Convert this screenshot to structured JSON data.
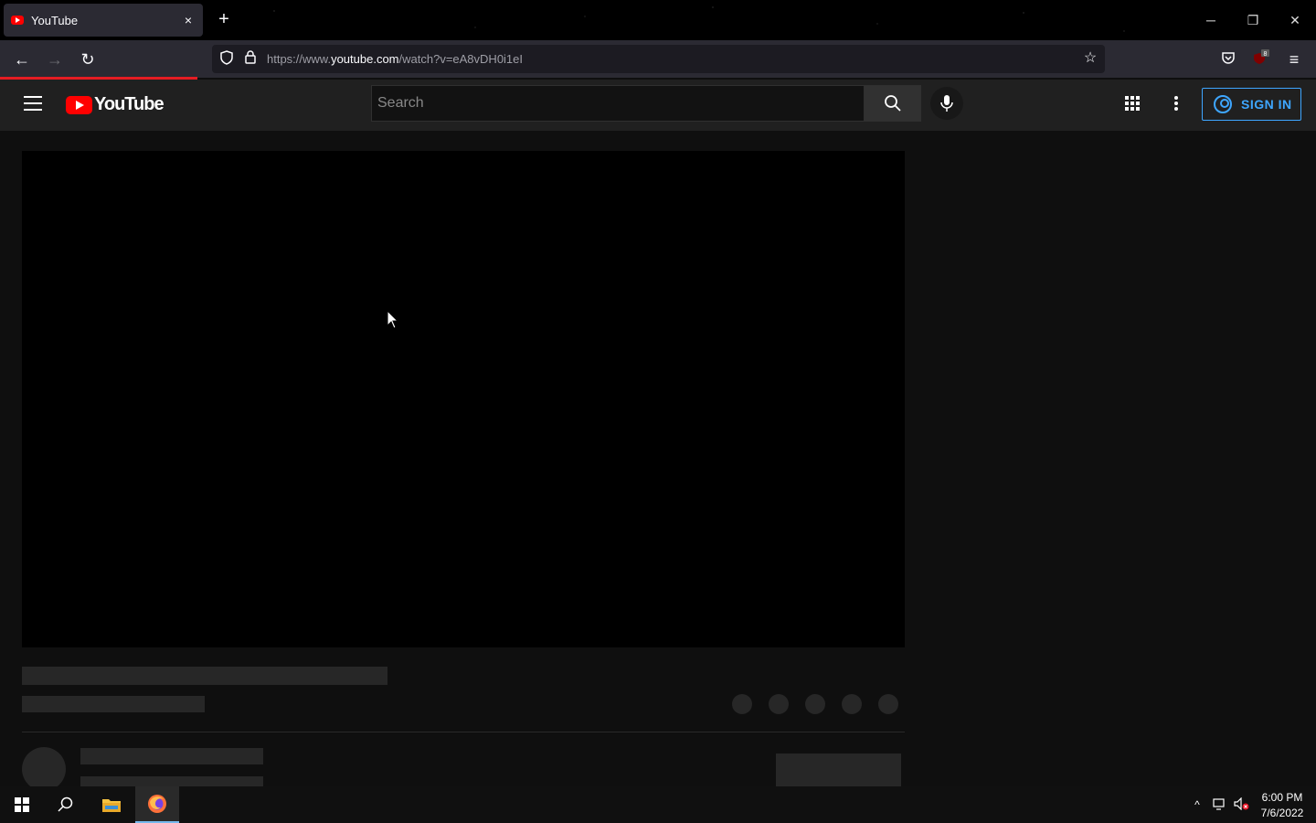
{
  "browser": {
    "tab": {
      "title": "YouTube",
      "close": "×"
    },
    "new_tab": "+",
    "window_controls": {
      "minimize": "─",
      "restore": "❐",
      "close": "✕"
    },
    "nav": {
      "back": "←",
      "forward": "→",
      "reload": "↻"
    },
    "url": {
      "prefix": "https://www.",
      "host": "youtube.com",
      "path": "/watch?v=eA8vDH0i1eI"
    },
    "extensions": {
      "ublock_badge": "8"
    },
    "menu": "≡"
  },
  "youtube": {
    "logo_text": "YouTube",
    "search": {
      "placeholder": "Search"
    },
    "sign_in_label": "SIGN IN"
  },
  "taskbar": {
    "clock": {
      "time": "6:00 PM",
      "date": "7/6/2022"
    },
    "tray_up": "^"
  },
  "colors": {
    "brand_red": "#ff0000",
    "accent_blue": "#3ea6ff",
    "progress_red": "#e51c23"
  }
}
